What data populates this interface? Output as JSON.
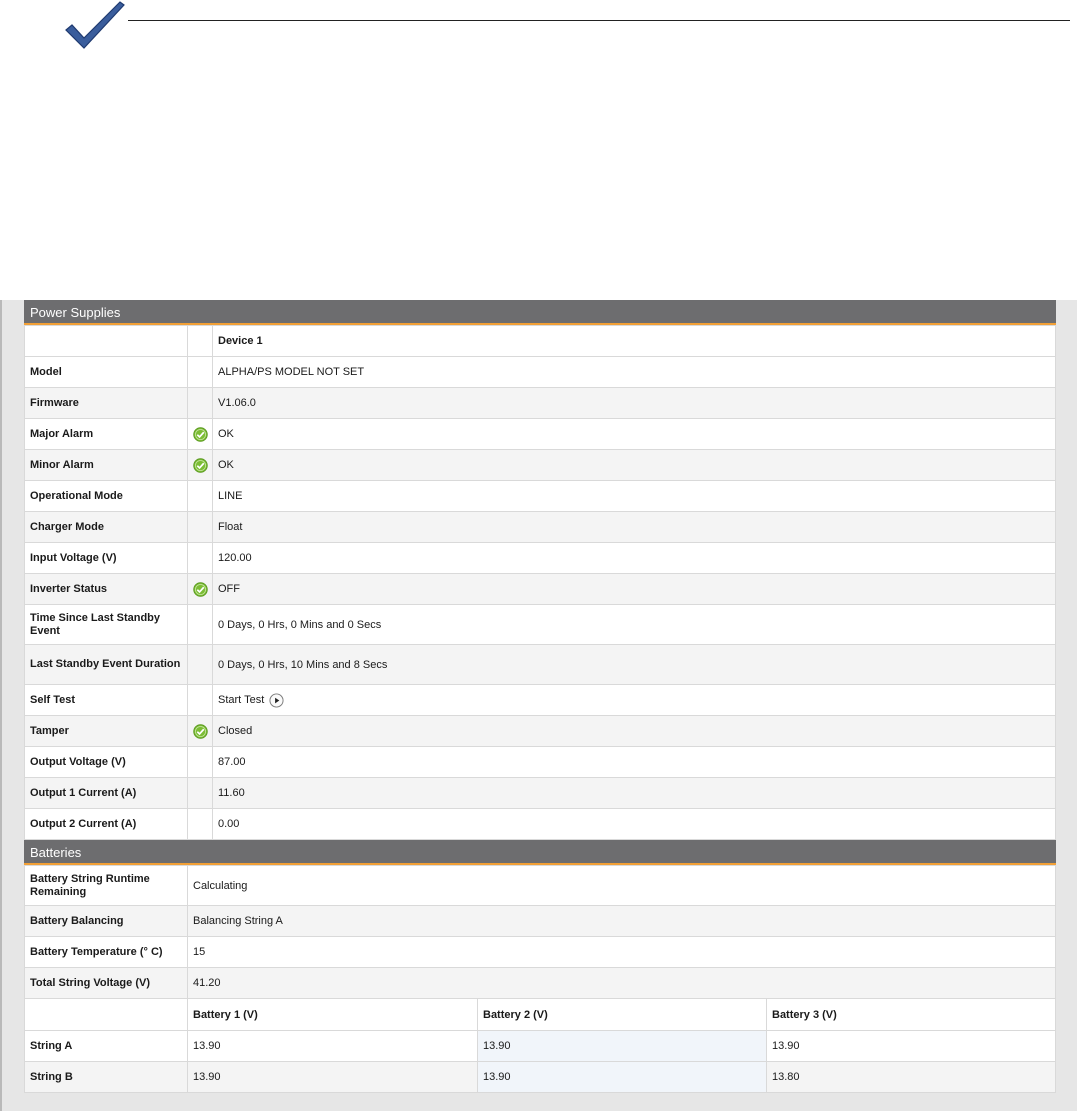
{
  "colors": {
    "header_bg": "#6d6d6f",
    "header_accent": "#f2a036",
    "ok_green": "#7cbd35",
    "check_blue": "#3a5d9c"
  },
  "power_supplies": {
    "title": "Power Supplies",
    "device_header": "Device 1",
    "rows": [
      {
        "label": "Model",
        "value": "ALPHA/PS MODEL NOT SET",
        "icon": ""
      },
      {
        "label": "Firmware",
        "value": "V1.06.0",
        "icon": ""
      },
      {
        "label": "Major Alarm",
        "value": "OK",
        "icon": "ok-check-icon"
      },
      {
        "label": "Minor Alarm",
        "value": "OK",
        "icon": "ok-check-icon"
      },
      {
        "label": "Operational Mode",
        "value": "LINE",
        "icon": ""
      },
      {
        "label": "Charger Mode",
        "value": "Float",
        "icon": ""
      },
      {
        "label": "Input Voltage (V)",
        "value": "120.00",
        "icon": ""
      },
      {
        "label": "Inverter Status",
        "value": "OFF",
        "icon": "ok-check-icon"
      },
      {
        "label": "Time Since Last Standby Event",
        "value": "0 Days, 0 Hrs, 0 Mins and 0 Secs",
        "icon": ""
      },
      {
        "label": "Last Standby Event Duration",
        "value": "0 Days, 0 Hrs, 10 Mins and 8 Secs",
        "icon": ""
      },
      {
        "label": "Self Test",
        "value": "Start Test",
        "icon": "play-icon"
      },
      {
        "label": "Tamper",
        "value": "Closed",
        "icon": "ok-check-icon"
      },
      {
        "label": "Output Voltage (V)",
        "value": "87.00",
        "icon": ""
      },
      {
        "label": "Output 1 Current (A)",
        "value": "11.60",
        "icon": ""
      },
      {
        "label": "Output 2 Current (A)",
        "value": "0.00",
        "icon": ""
      }
    ]
  },
  "batteries": {
    "title": "Batteries",
    "rows": [
      {
        "label": "Battery String Runtime Remaining",
        "value": "Calculating"
      },
      {
        "label": "Battery Balancing",
        "value": "Balancing String A"
      },
      {
        "label": "Battery Temperature (° C)",
        "value": "15"
      },
      {
        "label": "Total String Voltage (V)",
        "value": "41.20"
      }
    ],
    "columns": [
      "Battery 1 (V)",
      "Battery 2 (V)",
      "Battery 3 (V)"
    ],
    "strings": [
      {
        "label": "String A",
        "values": [
          "13.90",
          "13.90",
          "13.90"
        ]
      },
      {
        "label": "String B",
        "values": [
          "13.90",
          "13.90",
          "13.80"
        ]
      }
    ]
  }
}
